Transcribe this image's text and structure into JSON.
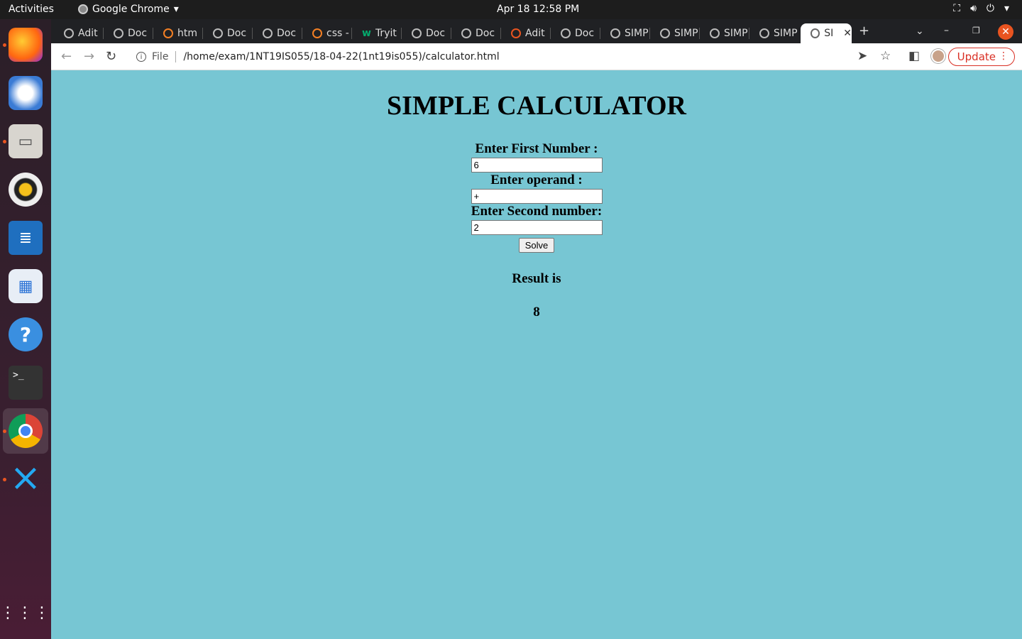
{
  "topbar": {
    "activities": "Activities",
    "app_name": "Google Chrome",
    "clock": "Apr 18  12:58 PM"
  },
  "tabs": [
    {
      "label": "Adit"
    },
    {
      "label": "Doc"
    },
    {
      "label": "htm"
    },
    {
      "label": "Doc"
    },
    {
      "label": "Doc"
    },
    {
      "label": "css -"
    },
    {
      "label": "Tryit"
    },
    {
      "label": "Doc"
    },
    {
      "label": "Doc"
    },
    {
      "label": "Adit"
    },
    {
      "label": "Doc"
    },
    {
      "label": "SIMP"
    },
    {
      "label": "SIMP"
    },
    {
      "label": "SIMP"
    },
    {
      "label": "SIMP"
    },
    {
      "label": "SI"
    }
  ],
  "toolbar": {
    "file_label": "File",
    "url": "/home/exam/1NT19IS055/18-04-22(1nt19is055)/calculator.html",
    "update_label": "Update"
  },
  "page": {
    "title": "SIMPLE CALCULATOR",
    "first_label": "Enter First Number :",
    "first_value": "6",
    "operand_label": "Enter operand :",
    "operand_value": "+",
    "second_label": "Enter Second number:",
    "second_value": "2",
    "solve_label": "Solve",
    "result_label": "Result is",
    "result_value": "8"
  },
  "colors": {
    "page_background": "#77c6d3",
    "tabstrip": "#202124",
    "accent": "#e95420"
  }
}
